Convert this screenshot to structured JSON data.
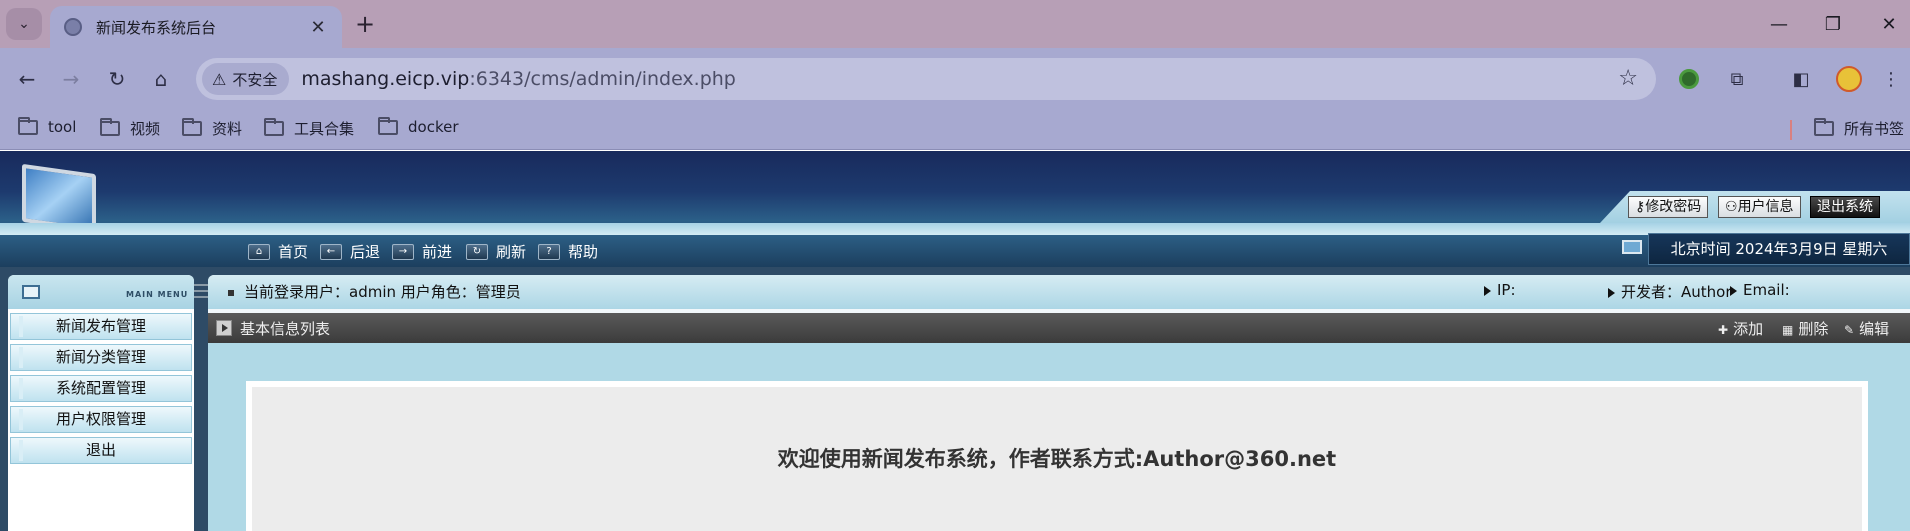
{
  "browser": {
    "tab_title": "新闻发布系统后台",
    "tab_close": "✕",
    "new_tab": "+",
    "security_label": "不安全",
    "url_host": "mashang.eicp.vip",
    "url_path": ":6343/cms/admin/index.php",
    "bookmarks": [
      "tool",
      "视频",
      "资料",
      "工具合集",
      "docker"
    ],
    "all_bookmarks": "所有书签"
  },
  "header": {
    "user_buttons": {
      "change_password": "修改密码",
      "user_info": "用户信息",
      "logout": "退出系统"
    },
    "quick_nav": [
      "首页",
      "后退",
      "前进",
      "刷新",
      "帮助"
    ],
    "clock": "北京时间 2024年3月9日 星期六"
  },
  "sidebar": {
    "title": "MAIN MENU",
    "items": [
      "新闻发布管理",
      "新闻分类管理",
      "系统配置管理",
      "用户权限管理",
      "退出"
    ]
  },
  "info_bar": {
    "login_text": "当前登录用户：admin 用户角色：管理员",
    "ip": "IP:",
    "developer": "开发者：Author",
    "email": "Email:"
  },
  "panel": {
    "title": "基本信息列表",
    "actions": [
      "添加",
      "删除",
      "编辑"
    ],
    "welcome": "欢迎使用新闻发布系统，作者联系方式:Author@360.net"
  }
}
